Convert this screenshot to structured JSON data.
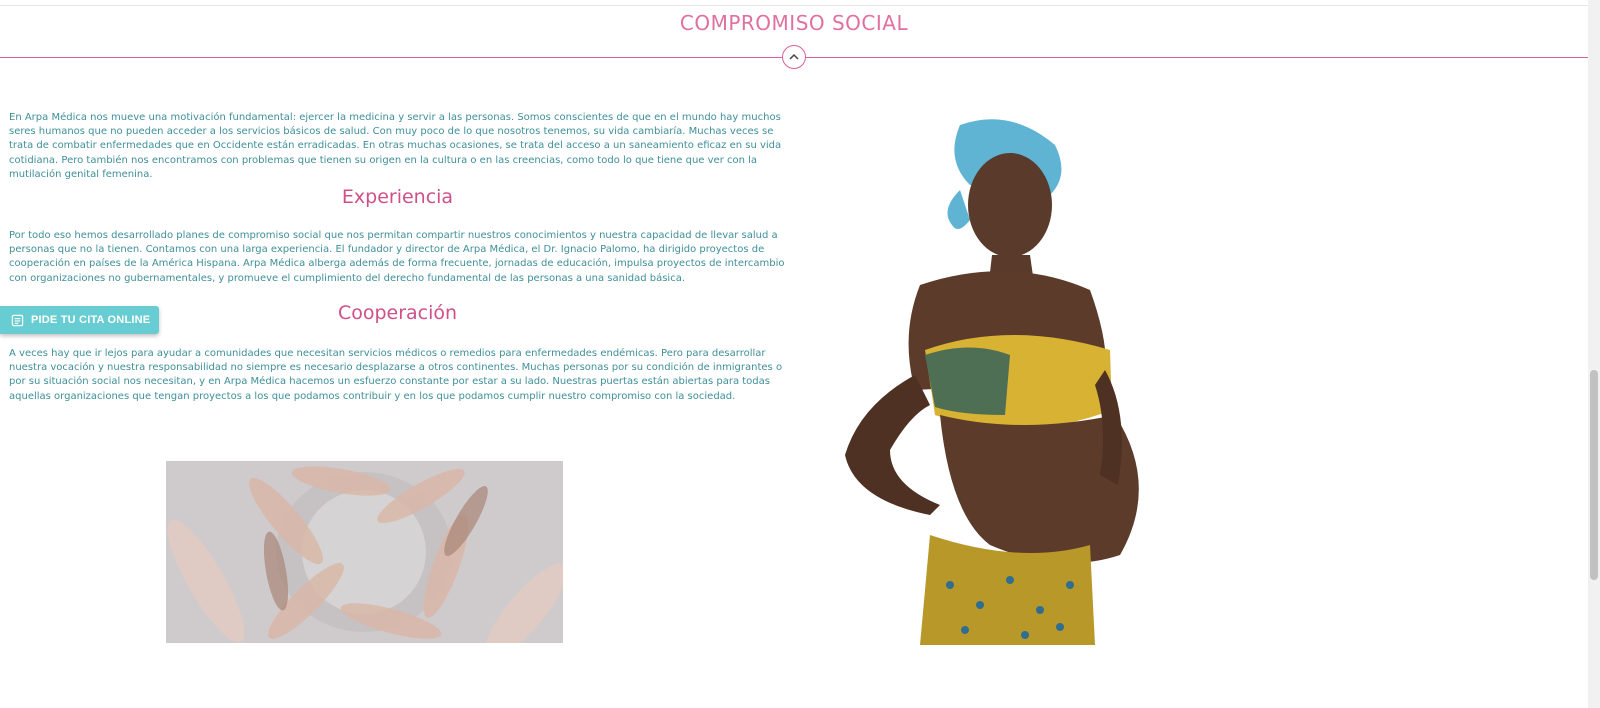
{
  "section": {
    "title": "COMPROMISO SOCIAL"
  },
  "intro": "En Arpa Médica nos mueve una motivación fundamental: ejercer la medicina y servir a las personas. Somos conscientes de que en el mundo hay muchos seres humanos que no pueden acceder a los servicios básicos de salud. Con muy poco de lo que nosotros tenemos, su vida cambiaría. Muchas veces se trata de combatir enfermedades que en Occidente están erradicadas. En otras muchas ocasiones, se trata del acceso a un saneamiento eficaz en su vida cotidiana. Pero también nos encontramos con problemas que tienen su origen en la cultura o en las creencias, como todo lo que tiene que ver con la mutilación genital femenina.",
  "experiencia": {
    "heading": "Experiencia",
    "text": "Por todo eso hemos desarrollado planes de compromiso social que nos permitan compartir nuestros conocimientos y nuestra capacidad de llevar salud a personas que no la tienen. Contamos con una larga experiencia. El fundador y director de Arpa Médica, el Dr. Ignacio Palomo, ha dirigido proyectos de cooperación en países de la América Hispana. Arpa Médica alberga además de forma frecuente, jornadas de educación, impulsa proyectos de intercambio con organizaciones no gubernamentales, y promueve el cumplimiento del derecho fundamental de las personas a una sanidad básica."
  },
  "cooperacion": {
    "heading": "Cooperación",
    "text": "A veces hay que ir lejos para ayudar a comunidades que necesitan servicios médicos o remedios para enfermedades endémicas. Pero para desarrollar nuestra vocación y nuestra responsabilidad no siempre es necesario desplazarse a otros continentes. Muchas personas por su condición de inmigrantes o por su situación social nos necesitan, y en Arpa Médica hacemos un esfuerzo constante por estar a su lado. Nuestras puertas están abiertas para todas aquellas organizaciones que tengan proyectos a los que podamos contribuir y en los que podamos cumplir nuestro compromiso con la sociedad."
  },
  "cta": {
    "label": "PIDE TU CITA ONLINE",
    "icon": "calendar-list-icon"
  },
  "icons": {
    "collapse": "chevron-up-icon"
  },
  "colors": {
    "accent_pink": "#d9609a",
    "heading_pink": "#cf4f8a",
    "text_teal": "#3f8f98",
    "cta_teal": "#67cdd2"
  }
}
